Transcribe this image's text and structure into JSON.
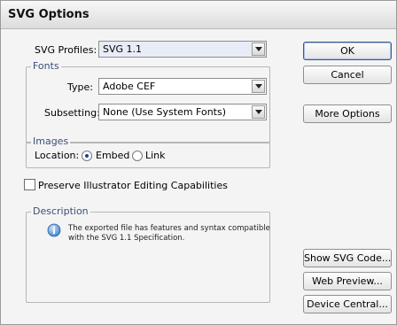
{
  "window": {
    "title": "SVG Options"
  },
  "svg_profiles": {
    "label": "SVG Profiles:",
    "value": "SVG 1.1"
  },
  "fonts": {
    "legend": "Fonts",
    "type": {
      "label": "Type:",
      "value": "Adobe CEF"
    },
    "subsetting": {
      "label": "Subsetting:",
      "value": "None (Use System Fonts)"
    }
  },
  "images": {
    "legend": "Images",
    "location_label": "Location:",
    "options": [
      {
        "label": "Embed",
        "selected": true
      },
      {
        "label": "Link",
        "selected": false
      }
    ]
  },
  "preserve": {
    "label": "Preserve Illustrator Editing Capabilities",
    "checked": false
  },
  "description": {
    "legend": "Description",
    "lines": [
      "The exported file has features and syntax compatible",
      "with the SVG 1.1 Specification."
    ],
    "icon": "info-icon"
  },
  "buttons": {
    "ok": "OK",
    "cancel": "Cancel",
    "more_options": "More Options",
    "show_svg_code": "Show SVG Code...",
    "web_preview": "Web Preview...",
    "device_central": "Device Central..."
  },
  "colors": {
    "legend_text": "#3a4f7a",
    "selection_dot": "#1d3f8f"
  }
}
